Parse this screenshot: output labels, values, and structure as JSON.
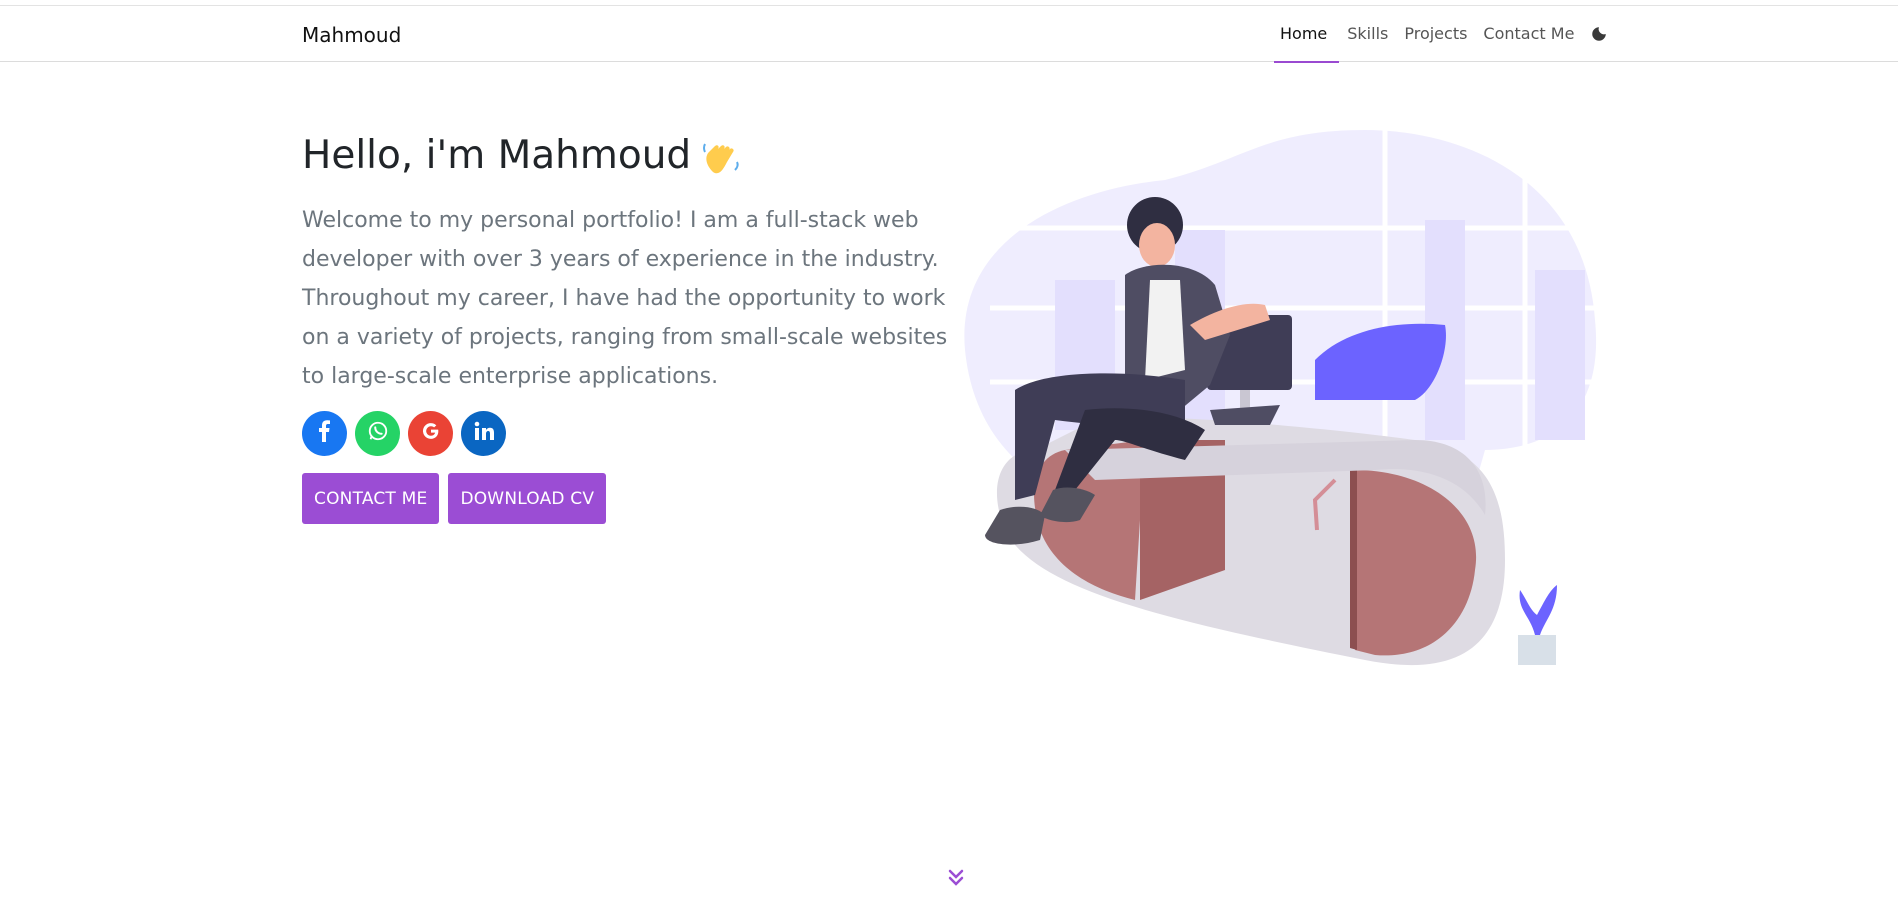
{
  "navbar": {
    "brand": "Mahmoud",
    "links": [
      {
        "label": "Home",
        "active": true
      },
      {
        "label": "Skills",
        "active": false
      },
      {
        "label": "Projects",
        "active": false
      },
      {
        "label": "Contact Me",
        "active": false
      }
    ],
    "theme_toggle_icon": "moon-icon"
  },
  "hero": {
    "title": "Hello, i'm Mahmoud",
    "title_emoji_icon": "waving-hand-icon",
    "description": "Welcome to my personal portfolio! I am a full-stack web developer with over 3 years of experience in the industry. Throughout my career, I have had the opportunity to work on a variety of projects, ranging from small-scale websites to large-scale enterprise applications.",
    "socials": [
      {
        "icon": "facebook-icon",
        "color": "#1877f2"
      },
      {
        "icon": "whatsapp-icon",
        "color": "#25d366"
      },
      {
        "icon": "google-icon",
        "color": "#ea4335"
      },
      {
        "icon": "linkedin-icon",
        "color": "#0a66c2"
      }
    ],
    "buttons": {
      "contact": "CONTACT ME",
      "cv": "DOWNLOAD CV"
    }
  },
  "colors": {
    "accent": "#9b4dd4",
    "text_muted": "#6c757d",
    "illustration_blob": "#efedfe",
    "illustration_accent": "#6c63ff"
  },
  "scroll_indicator_icon": "double-chevron-down-icon"
}
